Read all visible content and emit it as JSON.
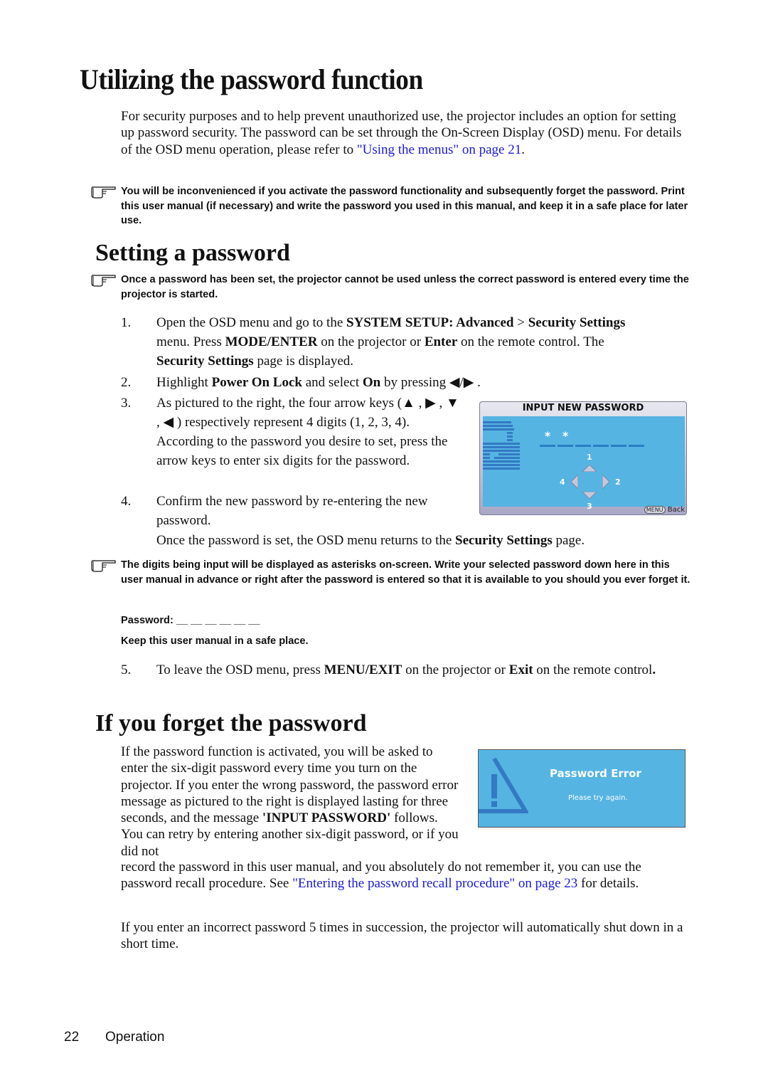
{
  "title": "Utilizing the password function",
  "intro": {
    "text1": "For security purposes and to help prevent unauthorized use, the projector includes an option for setting up password security. The password can be set through the On-Screen Display (OSD) menu. For details of the OSD menu operation, please refer to ",
    "link": "\"Using the menus\" on page 21",
    "text2": "."
  },
  "note1": "You will be inconvenienced if you activate the password functionality and subsequently forget the password. Print this user manual (if necessary) and write the password you used in this manual, and keep it in a safe place for later use.",
  "setting": {
    "heading": "Setting a password",
    "note": "Once a password has been set, the projector cannot be used unless the correct password is entered every time the projector is started.",
    "steps": [
      {
        "num": "1.",
        "parts": [
          "Open the OSD menu and go to the ",
          "SYSTEM SETUP: Advanced",
          " > ",
          "Security Settings",
          " menu. Press ",
          "MODE/ENTER",
          " on the projector or ",
          "Enter",
          " on the remote control. The ",
          "Security Settings",
          " page is displayed."
        ]
      },
      {
        "num": "2.",
        "parts": [
          "Highlight ",
          "Power On Lock",
          " and select ",
          "On",
          " by pressing ◀/▶ ."
        ]
      },
      {
        "num": "3.",
        "text": "As pictured to the right, the four arrow keys (▲ , ▶ , ▼ , ◀ ) respectively represent 4 digits (1, 2, 3, 4). According to the password you desire to set, press the arrow keys to enter six digits for the password."
      },
      {
        "num": "4.",
        "text": "Confirm the new password by re-entering the new password."
      }
    ],
    "after_steps": [
      "Once the password is set, the OSD menu returns to the ",
      "Security Settings",
      " page."
    ],
    "note2": "The digits being input will be displayed as asterisks on-screen. Write your selected password down here in this user manual in advance or right after the password is entered so that it is available to you should you ever forget it.",
    "password_label": "Password: __ __ __ __ __ __",
    "keep_label": "Keep this user manual in a safe place.",
    "step5": {
      "num": "5.",
      "parts": [
        "To leave the OSD menu, press ",
        "MENU/EXIT",
        " on the projector or ",
        "Exit",
        " on the remote control",
        "."
      ]
    }
  },
  "osd_input": {
    "header": "INPUT NEW PASSWORD",
    "entered": [
      "*",
      "*"
    ],
    "slots": 6,
    "digit_up": "1",
    "digit_right": "2",
    "digit_down": "3",
    "digit_left": "4",
    "menu_key": "MENU",
    "back_label": "Back"
  },
  "forget": {
    "heading": "If you forget the password",
    "para1_a": "If the password function is activated, you will be asked to enter the six-digit password every time you turn on the projector. If you enter the wrong password, the password error message as pictured to the right is displayed lasting for three seconds, and the message ",
    "para1_bold": "'INPUT PASSWORD'",
    "para1_b": " follows. You can retry by entering another six-digit password, or if you did not",
    "para1_c": "record the password in this user manual, and you absolutely do not remember it, you can use the password recall procedure. See ",
    "para1_link": "\"Entering the password recall procedure\" on page 23",
    "para1_d": " for details.",
    "para2": "If you enter an incorrect password 5 times in succession, the projector will automatically shut down in a short time."
  },
  "osd_error": {
    "title": "Password Error",
    "subtitle": "Please try again."
  },
  "footer": {
    "page_number": "22",
    "section": "Operation"
  }
}
